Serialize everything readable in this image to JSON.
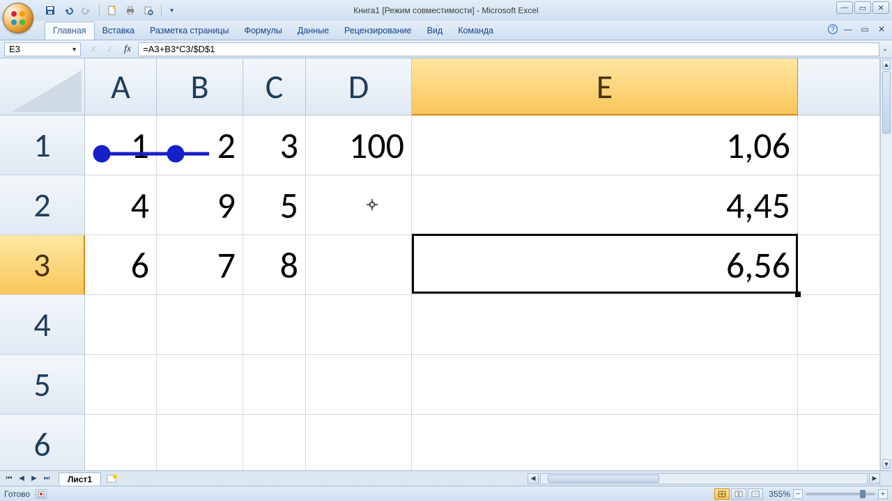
{
  "window": {
    "title": "Книга1  [Режим совместимости] - Microsoft Excel"
  },
  "ribbon": {
    "tabs": [
      "Главная",
      "Вставка",
      "Разметка страницы",
      "Формулы",
      "Данные",
      "Рецензирование",
      "Вид",
      "Команда"
    ],
    "active_index": 0
  },
  "formula_bar": {
    "name_box": "E3",
    "formula": "=A3+B3*C3/$D$1",
    "fx_label": "fx"
  },
  "columns": [
    "A",
    "B",
    "C",
    "D",
    "E"
  ],
  "selected_column_index": 4,
  "row_headers": [
    "1",
    "2",
    "3",
    "4",
    "5",
    "6"
  ],
  "selected_row_index": 2,
  "cells": {
    "r1": {
      "A": "1",
      "B": "2",
      "C": "3",
      "D": "100",
      "E": "1,06"
    },
    "r2": {
      "A": "4",
      "B": "9",
      "C": "5",
      "D": "",
      "E": "4,45"
    },
    "r3": {
      "A": "6",
      "B": "7",
      "C": "8",
      "D": "",
      "E": "6,56"
    },
    "r4": {
      "A": "",
      "B": "",
      "C": "",
      "D": "",
      "E": ""
    },
    "r5": {
      "A": "",
      "B": "",
      "C": "",
      "D": "",
      "E": ""
    },
    "r6": {
      "A": "",
      "B": "",
      "C": "",
      "D": "",
      "E": ""
    }
  },
  "sheet_tabs": {
    "active": "Лист1"
  },
  "statusbar": {
    "ready": "Готово",
    "zoom": "355%"
  },
  "colors": {
    "arrow": "#1520c8"
  }
}
